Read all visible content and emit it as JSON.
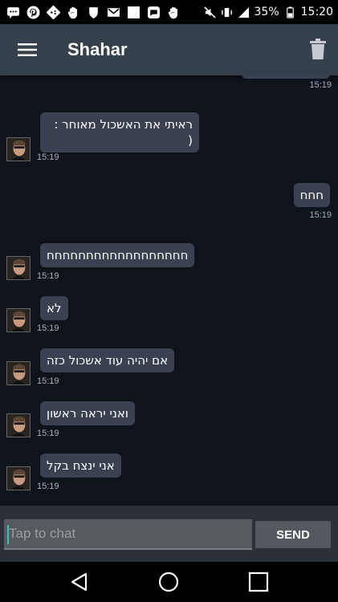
{
  "status_bar": {
    "battery": "35%",
    "time": "15:20",
    "left_icons": [
      "sms-icon",
      "pinterest-icon",
      "dominos-icon",
      "hand-icon",
      "shield-icon",
      "gmail-icon",
      "square-icon",
      "chat-app-icon",
      "hand-icon"
    ],
    "right_icons": [
      "mute-icon",
      "vibrate-icon",
      "signal-icon",
      "battery-icon"
    ]
  },
  "header": {
    "title": "Shahar",
    "menu_icon": "hamburger-menu-icon",
    "trash_icon": "trash-icon"
  },
  "colors": {
    "toolbar": "#363f4c",
    "background": "#0f141c",
    "bubble": "#3a4252",
    "accent": "#34c4b0"
  },
  "messages": [
    {
      "sender": "me",
      "text": "",
      "time": "15:19"
    },
    {
      "sender": "other",
      "text": "ראיתי את האשכול מאוחר :\n(",
      "time": "15:19"
    },
    {
      "sender": "me",
      "text": "חחח",
      "time": "15:19"
    },
    {
      "sender": "other",
      "text": "חחחחחחחחחחחחחחחחחח",
      "time": "15:19"
    },
    {
      "sender": "other",
      "text": "לא",
      "time": "15:19"
    },
    {
      "sender": "other",
      "text": "אם יהיה עוד אשכול כזה",
      "time": "15:19"
    },
    {
      "sender": "other",
      "text": "ואני יראה ראשון",
      "time": "15:19"
    },
    {
      "sender": "other",
      "text": "אני ינצח בקל",
      "time": "15:19"
    }
  ],
  "composer": {
    "placeholder": "Tap to chat",
    "send_label": "SEND"
  }
}
